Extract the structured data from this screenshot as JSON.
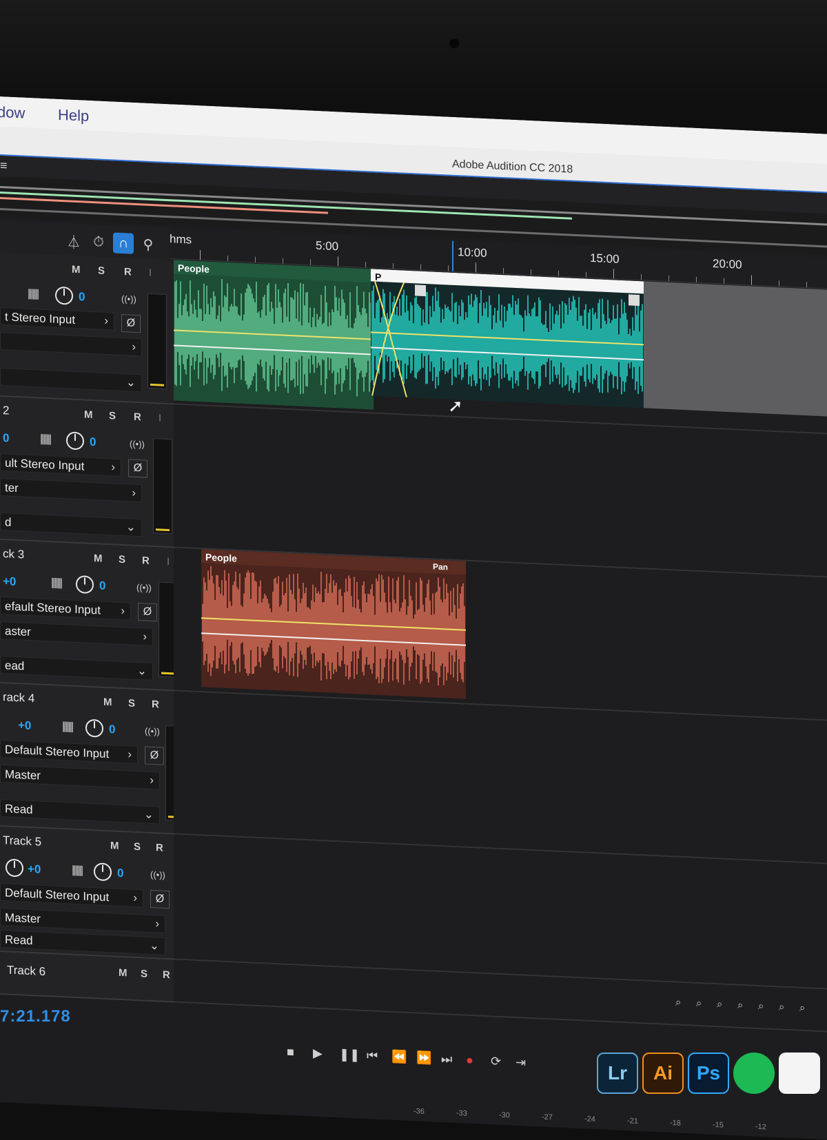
{
  "menu": {
    "items": [
      "dow",
      "Help"
    ]
  },
  "window": {
    "title": "Adobe Audition CC 2018"
  },
  "panel": {
    "menu_glyph": "≡"
  },
  "toolbar": {
    "tools": [
      "metronome-icon",
      "timestretch-icon",
      "headphones-icon",
      "marker-pin-icon"
    ],
    "active_tool": "headphones-icon"
  },
  "ruler": {
    "unit": "hms",
    "labels": [
      "5:00",
      "10:00",
      "15:00",
      "20:00"
    ]
  },
  "tracks": [
    {
      "name": "",
      "volume": "",
      "pan": "0",
      "input": "t Stereo Input",
      "output": "",
      "automation": "",
      "m": "M",
      "s": "S",
      "r": "R",
      "i": "I"
    },
    {
      "name": "2",
      "volume": "0",
      "pan": "0",
      "input": "ult Stereo Input",
      "output": "ter",
      "automation": "d",
      "m": "M",
      "s": "S",
      "r": "R",
      "i": "I"
    },
    {
      "name": "ck 3",
      "volume": "+0",
      "pan": "0",
      "input": "efault Stereo Input",
      "output": "aster",
      "automation": "ead",
      "m": "M",
      "s": "S",
      "r": "R",
      "i": "I"
    },
    {
      "name": "rack 4",
      "volume": "+0",
      "pan": "0",
      "input": "Default Stereo Input",
      "output": "Master",
      "automation": "Read",
      "m": "M",
      "s": "S",
      "r": "R",
      "i": "I"
    },
    {
      "name": "Track 5",
      "volume": "+0",
      "pan": "0",
      "input": "Default Stereo Input",
      "output": "Master",
      "automation": "Read",
      "m": "M",
      "s": "S",
      "r": "R",
      "i": "I"
    },
    {
      "name": "Track 6",
      "m": "M",
      "s": "S",
      "r": "R",
      "i": "I"
    }
  ],
  "clips": {
    "track1_a": {
      "label": "People",
      "color": "#6fe0a4"
    },
    "track1_b": {
      "label": "P",
      "color": "#29f0e0"
    },
    "track3": {
      "label": "People",
      "pan_label": "Pan",
      "color": "#f07a63"
    }
  },
  "transport": {
    "buttons": [
      "stop-icon",
      "play-icon",
      "pause-icon",
      "to-start-icon",
      "rewind-icon",
      "fast-forward-icon",
      "to-end-icon",
      "record-icon",
      "loop-icon",
      "skip-icon"
    ]
  },
  "time_display": "7:21.178",
  "level_meter_ticks": [
    "-36",
    "-33",
    "-30",
    "-27",
    "-24",
    "-21",
    "-18",
    "-15",
    "-12"
  ],
  "dock": {
    "apps": [
      "Lr",
      "Ai",
      "Ps",
      "Spotify",
      "Music"
    ]
  },
  "colors": {
    "accent": "#2f8fe6",
    "record": "#e53935",
    "volume_line": "#f0e26a"
  }
}
